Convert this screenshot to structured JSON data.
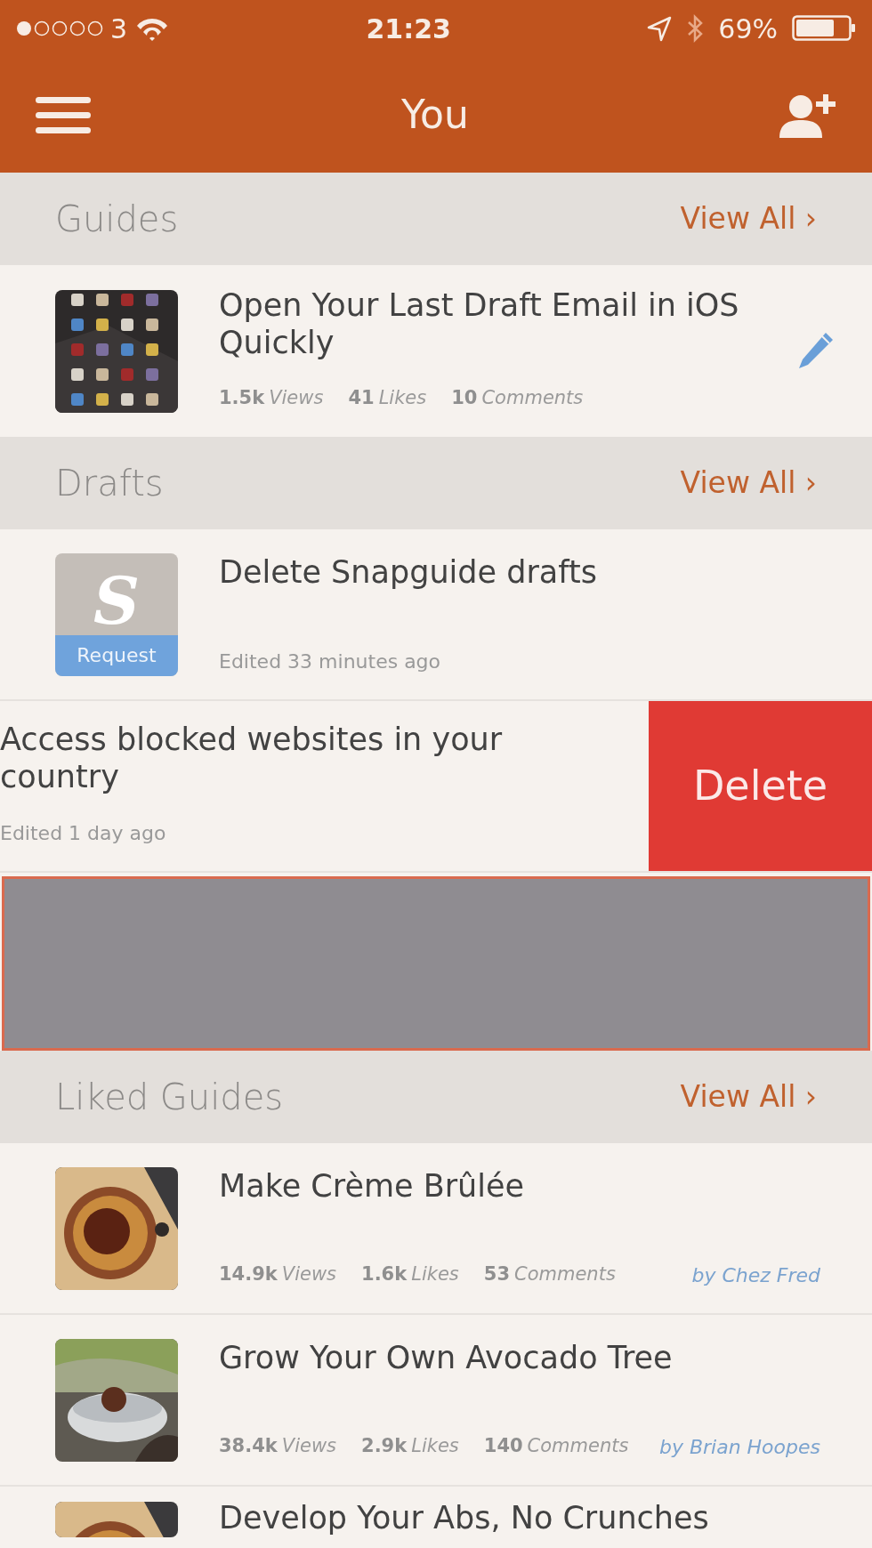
{
  "status_bar": {
    "carrier": "3",
    "time": "21:23",
    "battery": "69%"
  },
  "nav": {
    "title": "You"
  },
  "sections": [
    {
      "title": "Guides",
      "view_all": "View All ›",
      "items": [
        {
          "kind": "guide",
          "title": "Open Your Last Draft Email in iOS Quickly",
          "editable": true,
          "stats": [
            {
              "count": "1.5k",
              "unit": "Views"
            },
            {
              "count": "41",
              "unit": "Likes"
            },
            {
              "count": "10",
              "unit": "Comments"
            }
          ]
        }
      ]
    },
    {
      "title": "Drafts",
      "view_all": "View All ›",
      "items": [
        {
          "kind": "draft",
          "title": "Delete Snapguide drafts",
          "edited": "Edited 33 minutes ago",
          "logo": "S",
          "badge": "Request"
        },
        {
          "kind": "swiped",
          "title": "Access blocked websites in your country",
          "edited": "Edited 1 day ago",
          "action": "Delete"
        },
        {
          "kind": "placeholder"
        }
      ]
    },
    {
      "title": "Liked Guides",
      "view_all": "View All ›",
      "items": [
        {
          "kind": "liked",
          "title": "Make Crème Brûlée",
          "author": "by Chez Fred",
          "stats": [
            {
              "count": "14.9k",
              "unit": "Views"
            },
            {
              "count": "1.6k",
              "unit": "Likes"
            },
            {
              "count": "53",
              "unit": "Comments"
            }
          ]
        },
        {
          "kind": "liked",
          "title": "Grow Your Own Avocado Tree",
          "author": "by Brian Hoopes",
          "stats": [
            {
              "count": "38.4k",
              "unit": "Views"
            },
            {
              "count": "2.9k",
              "unit": "Likes"
            },
            {
              "count": "140",
              "unit": "Comments"
            }
          ]
        },
        {
          "kind": "liked",
          "title": "Develop Your Abs, No Crunches"
        }
      ]
    }
  ]
}
